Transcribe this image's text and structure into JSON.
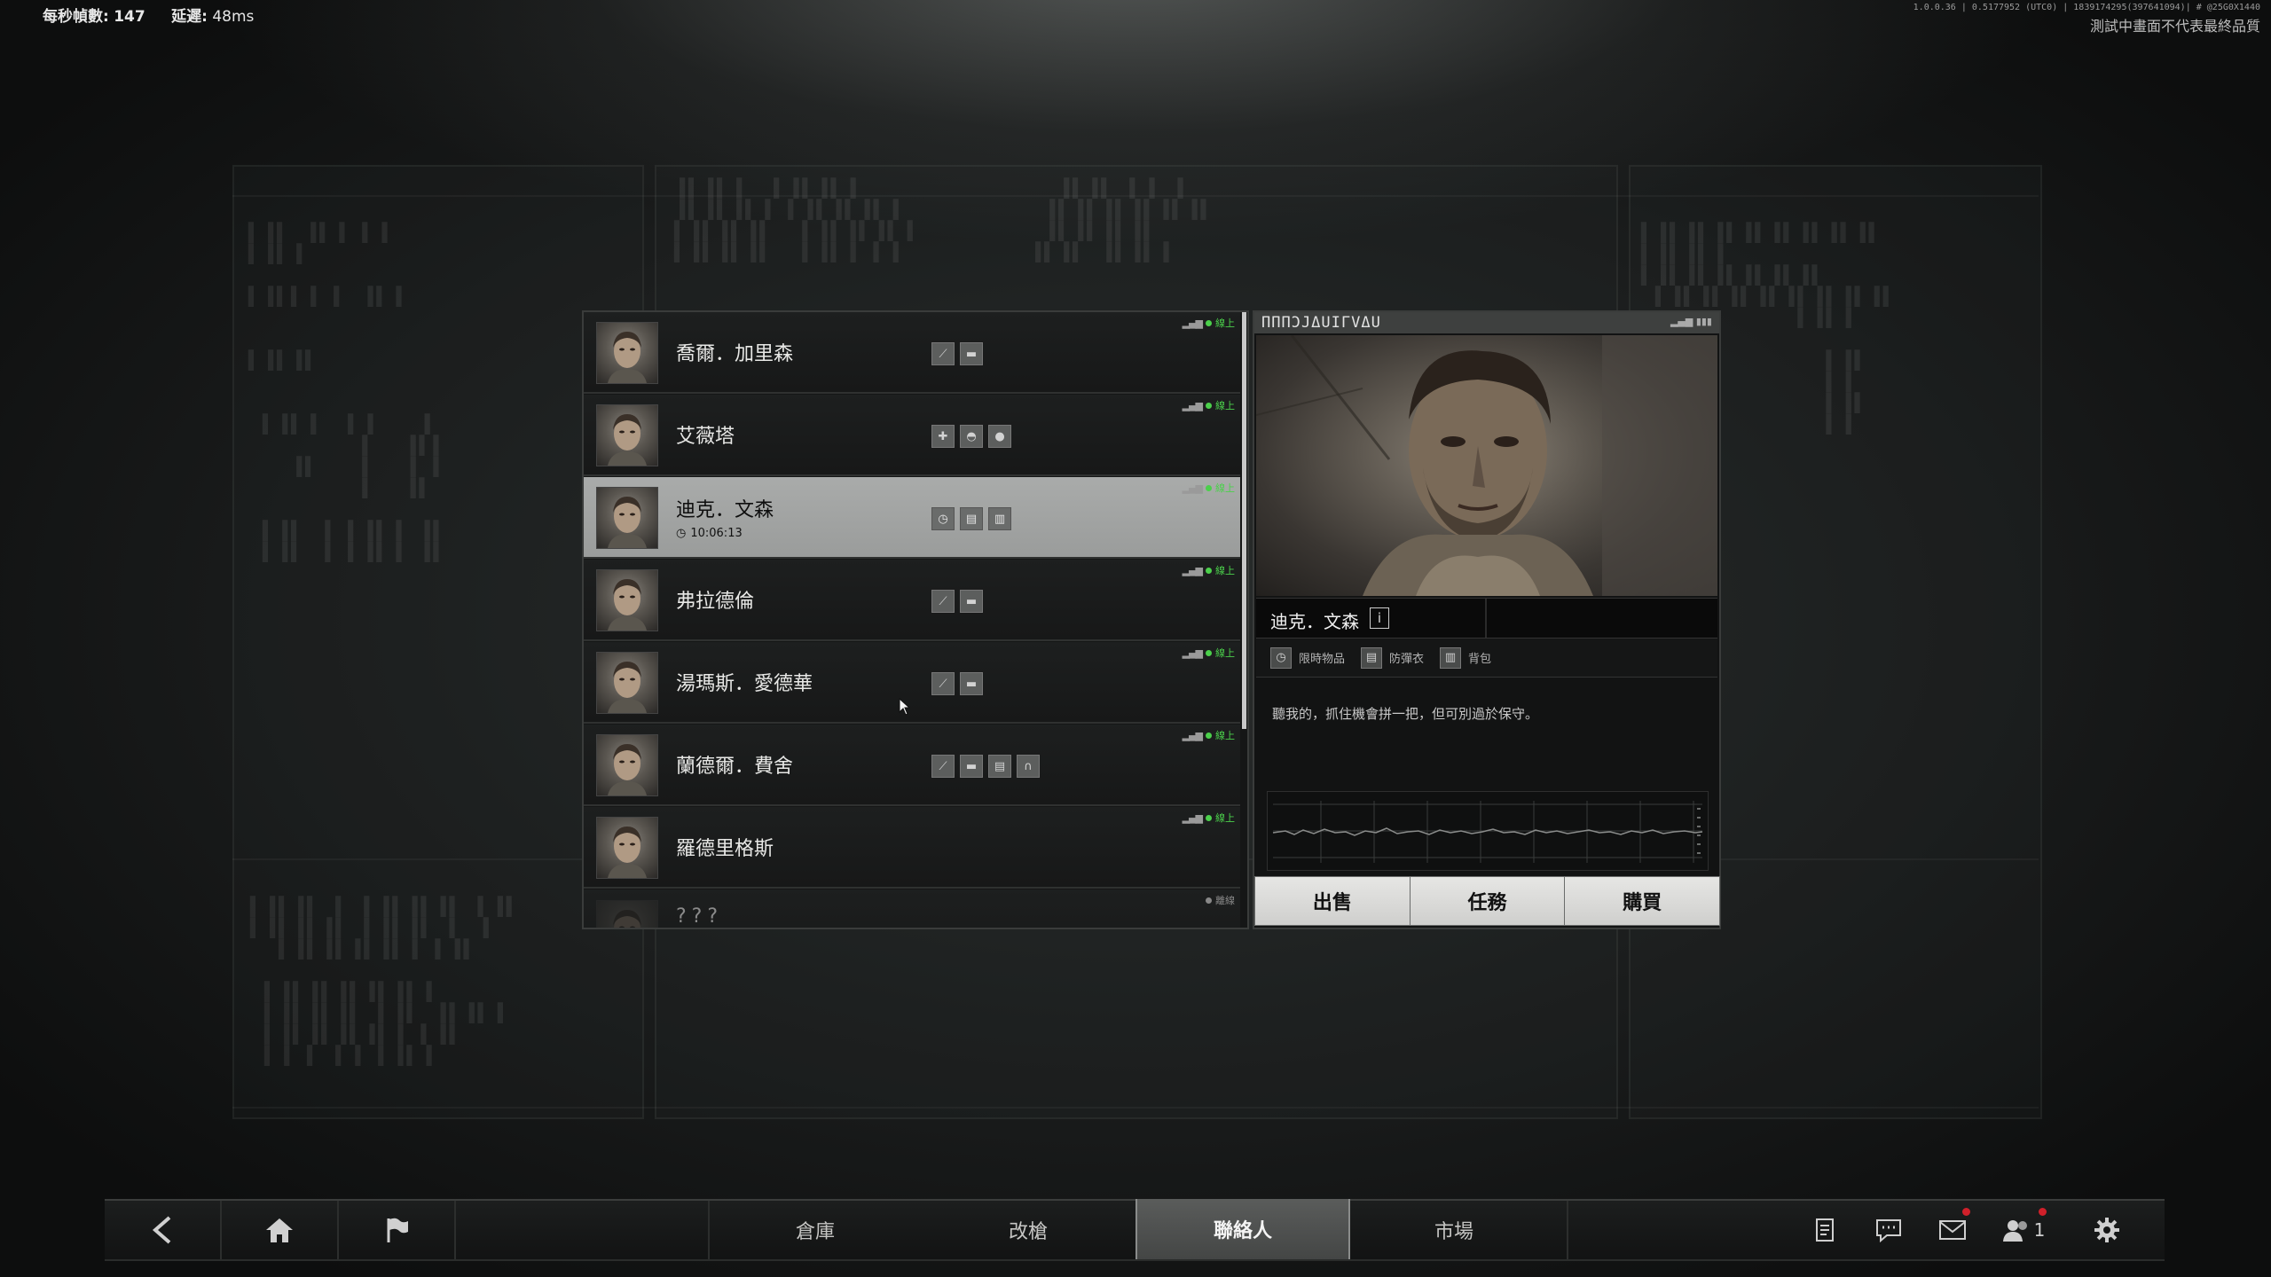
{
  "hud": {
    "fps_label": "每秒幀數:",
    "fps_value": "147",
    "latency_label": "延遲:",
    "latency_value": "48ms",
    "build_info": "1.0.0.36 | 0.5177952 (UTC0) | 1839174295(397641094)| # @25G0X1440",
    "disclaimer": "測試中畫面不代表最終品質"
  },
  "traders": [
    {
      "name": "喬爾．加里森",
      "timer": "",
      "icons": [
        "knife-icon",
        "bar-icon"
      ],
      "status": "線上",
      "online": true,
      "selected": false
    },
    {
      "name": "艾薇塔",
      "timer": "",
      "icons": [
        "pill-icon",
        "helmet-icon",
        "grenade-icon"
      ],
      "status": "線上",
      "online": true,
      "selected": false
    },
    {
      "name": "迪克．文森",
      "timer": "10:06:13",
      "icons": [
        "clock-icon",
        "vest-icon",
        "backpack-icon"
      ],
      "status": "線上",
      "online": true,
      "selected": true
    },
    {
      "name": "弗拉德倫",
      "timer": "",
      "icons": [
        "knife-icon",
        "bar-icon"
      ],
      "status": "線上",
      "online": true,
      "selected": false
    },
    {
      "name": "湯瑪斯．愛德華",
      "timer": "",
      "icons": [
        "knife-icon",
        "bar-icon"
      ],
      "status": "線上",
      "online": true,
      "selected": false
    },
    {
      "name": "蘭德爾．費舍",
      "timer": "",
      "icons": [
        "knife-icon",
        "bar-icon",
        "vest-icon",
        "headset-icon"
      ],
      "status": "線上",
      "online": true,
      "selected": false
    },
    {
      "name": "羅德里格斯",
      "timer": "",
      "icons": [],
      "status": "線上",
      "online": true,
      "selected": false
    },
    {
      "name": "???",
      "timer": "",
      "icons": [],
      "status": "離線",
      "online": false,
      "selected": false
    }
  ],
  "detail": {
    "header_code": "ΠΠΠƆJΔUIΓVΔU",
    "name": "迪克．文森",
    "info_label": "i",
    "categories": [
      {
        "icon": "clock-icon",
        "label": "限時物品"
      },
      {
        "icon": "vest-icon",
        "label": "防彈衣"
      },
      {
        "icon": "backpack-icon",
        "label": "背包"
      }
    ],
    "quote": "聽我的，抓住機會拼一把，但可別過於保守。",
    "actions": {
      "sell": "出售",
      "tasks": "任務",
      "buy": "購買"
    }
  },
  "nav": {
    "tabs": [
      "倉庫",
      "改槍",
      "聯絡人",
      "市場"
    ],
    "active_tab": "聯絡人",
    "friends_count": "1"
  },
  "colors": {
    "online": "#4bd04b",
    "notification": "#d0202a",
    "active_tab": "#4e504f"
  }
}
